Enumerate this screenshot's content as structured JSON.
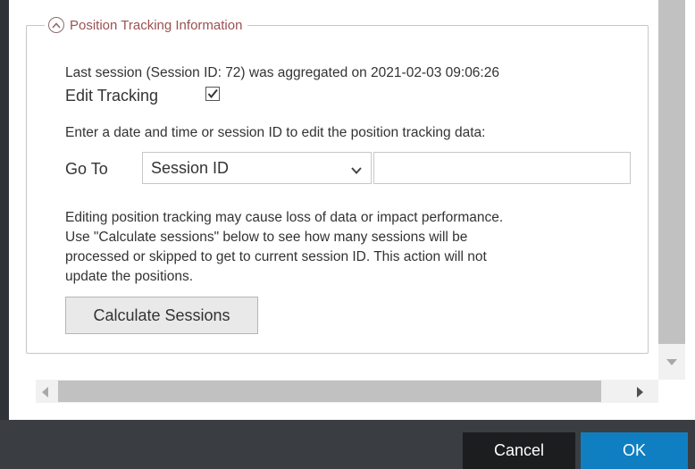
{
  "section": {
    "title": "Position Tracking Information",
    "collapse_icon": "chevron-up-circle-icon"
  },
  "info": {
    "last_session": "Last session (Session ID: 72) was aggregated on 2021-02-03 09:06:26",
    "edit_tracking_label": "Edit Tracking",
    "edit_tracking_checked": true,
    "instructions": "Enter a date and time or session ID to edit the position tracking data:"
  },
  "goto": {
    "label": "Go To",
    "selected": "Session ID",
    "value": ""
  },
  "warning_lines": [
    "Editing position tracking may cause loss of data or impact performance.",
    "Use \"Calculate sessions\" below to see how many sessions will be",
    "processed or skipped to get to current session ID. This action will not",
    "update the positions."
  ],
  "calculate_label": "Calculate Sessions",
  "footer": {
    "cancel_label": "Cancel",
    "ok_label": "OK"
  },
  "colors": {
    "accent": "#0f7fc2",
    "legend_title": "#9a5151",
    "footer_bg": "#3a3d41"
  }
}
